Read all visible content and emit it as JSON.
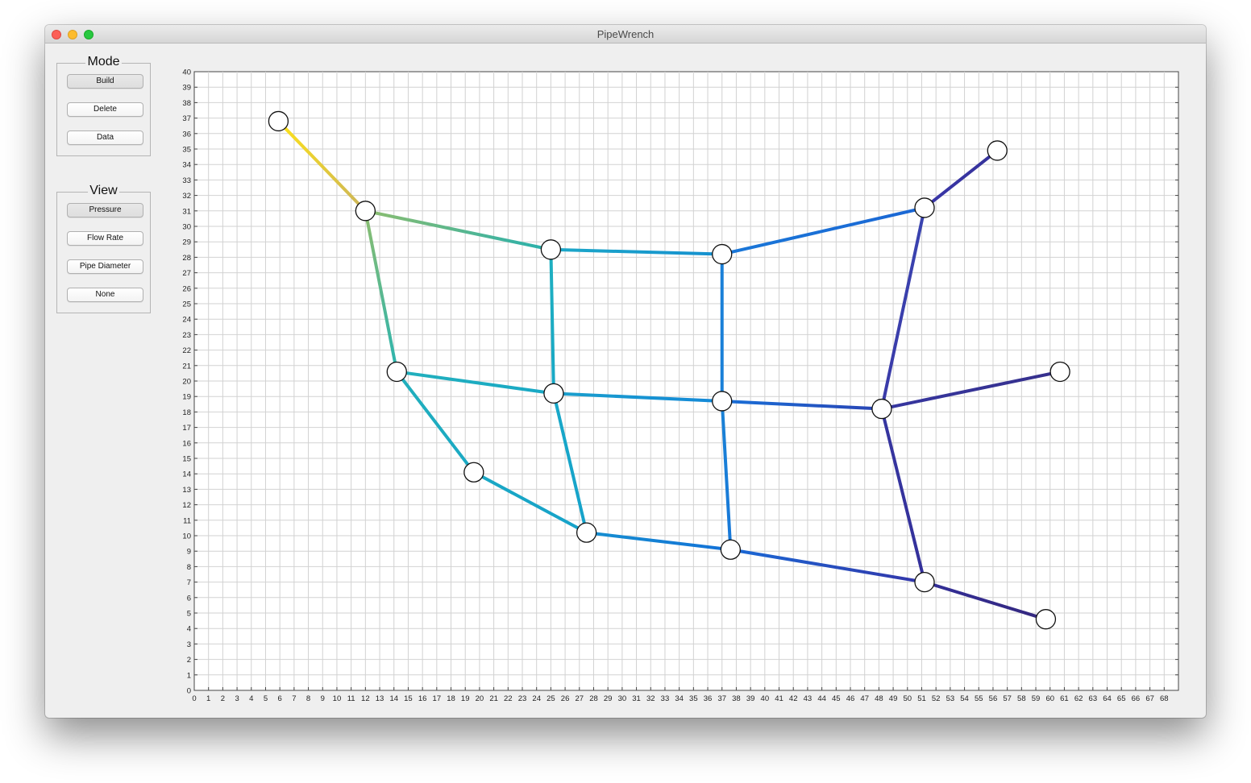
{
  "window": {
    "title": "PipeWrench"
  },
  "mode_panel": {
    "title": "Mode",
    "buttons": [
      {
        "label": "Build",
        "pressed": true
      },
      {
        "label": "Delete",
        "pressed": false
      },
      {
        "label": "Data",
        "pressed": false
      }
    ]
  },
  "view_panel": {
    "title": "View",
    "buttons": [
      {
        "label": "Pressure",
        "pressed": true
      },
      {
        "label": "Flow Rate",
        "pressed": false
      },
      {
        "label": "Pipe Diameter",
        "pressed": false
      },
      {
        "label": "None",
        "pressed": false
      }
    ]
  },
  "chart_data": {
    "type": "scatter",
    "title": "",
    "xlabel": "",
    "ylabel": "",
    "xlim": [
      0,
      69
    ],
    "ylim": [
      0,
      40
    ],
    "x_ticks_step": 1,
    "y_ticks_step": 1,
    "grid": true,
    "nodes": [
      {
        "id": "n1",
        "x": 5.9,
        "y": 36.8,
        "value_color": "#f5dc1e"
      },
      {
        "id": "n2",
        "x": 12.0,
        "y": 31.0,
        "value_color": "#96c06a"
      },
      {
        "id": "n3",
        "x": 25.0,
        "y": 28.5,
        "value_color": "#20b0b8"
      },
      {
        "id": "n4",
        "x": 37.0,
        "y": 28.2,
        "value_color": "#1590d0"
      },
      {
        "id": "n5",
        "x": 51.2,
        "y": 31.2,
        "value_color": "#2a4ab0"
      },
      {
        "id": "n6",
        "x": 56.3,
        "y": 34.9,
        "value_color": "#33349a"
      },
      {
        "id": "n7",
        "x": 14.2,
        "y": 20.6,
        "value_color": "#2ab4b0"
      },
      {
        "id": "n8",
        "x": 25.2,
        "y": 19.2,
        "value_color": "#18a8c6"
      },
      {
        "id": "n9",
        "x": 37.0,
        "y": 18.7,
        "value_color": "#1488d8"
      },
      {
        "id": "n10",
        "x": 48.2,
        "y": 18.2,
        "value_color": "#3036a0"
      },
      {
        "id": "n11",
        "x": 60.7,
        "y": 20.6,
        "value_color": "#33308c"
      },
      {
        "id": "n12",
        "x": 19.6,
        "y": 14.1,
        "value_color": "#1aa8c4"
      },
      {
        "id": "n13",
        "x": 27.5,
        "y": 10.2,
        "value_color": "#16a2ca"
      },
      {
        "id": "n14",
        "x": 37.6,
        "y": 9.1,
        "value_color": "#126ed8"
      },
      {
        "id": "n15",
        "x": 51.2,
        "y": 7.0,
        "value_color": "#302e9c"
      },
      {
        "id": "n16",
        "x": 59.7,
        "y": 4.6,
        "value_color": "#33287e"
      }
    ],
    "pipes": [
      {
        "from": "n1",
        "to": "n2",
        "color_from": "#fde21a",
        "color_to": "#cbb45a"
      },
      {
        "from": "n2",
        "to": "n3",
        "color_from": "#8dbd6e",
        "color_to": "#26b0ae"
      },
      {
        "from": "n2",
        "to": "n7",
        "color_from": "#8dbd6e",
        "color_to": "#2ab4b0"
      },
      {
        "from": "n3",
        "to": "n4",
        "color_from": "#1ca8c8",
        "color_to": "#1590d0"
      },
      {
        "from": "n4",
        "to": "n5",
        "color_from": "#1a78d8",
        "color_to": "#1a66d4"
      },
      {
        "from": "n5",
        "to": "n6",
        "color_from": "#3a36a8",
        "color_to": "#35329a"
      },
      {
        "from": "n3",
        "to": "n8",
        "color_from": "#1fb0c0",
        "color_to": "#18a8c6"
      },
      {
        "from": "n4",
        "to": "n9",
        "color_from": "#1a80d8",
        "color_to": "#1a80d8"
      },
      {
        "from": "n5",
        "to": "n10",
        "color_from": "#3a44b0",
        "color_to": "#3a3aa8"
      },
      {
        "from": "n7",
        "to": "n8",
        "color_from": "#22b0bc",
        "color_to": "#18a8c6"
      },
      {
        "from": "n8",
        "to": "n9",
        "color_from": "#1aa0cc",
        "color_to": "#1488d8"
      },
      {
        "from": "n9",
        "to": "n10",
        "color_from": "#1870d8",
        "color_to": "#2a44b4"
      },
      {
        "from": "n10",
        "to": "n11",
        "color_from": "#3636a0",
        "color_to": "#36308c"
      },
      {
        "from": "n7",
        "to": "n12",
        "color_from": "#22b0bc",
        "color_to": "#1aa8c4"
      },
      {
        "from": "n8",
        "to": "n13",
        "color_from": "#18a8c8",
        "color_to": "#16a2ca"
      },
      {
        "from": "n9",
        "to": "n14",
        "color_from": "#1a82d6",
        "color_to": "#1878d8"
      },
      {
        "from": "n10",
        "to": "n15",
        "color_from": "#3636a0",
        "color_to": "#34309a"
      },
      {
        "from": "n12",
        "to": "n13",
        "color_from": "#1aa8c4",
        "color_to": "#16a2ca"
      },
      {
        "from": "n13",
        "to": "n14",
        "color_from": "#1690d0",
        "color_to": "#1270d8"
      },
      {
        "from": "n14",
        "to": "n15",
        "color_from": "#1a6ad6",
        "color_to": "#3334a8"
      },
      {
        "from": "n15",
        "to": "n16",
        "color_from": "#322e98",
        "color_to": "#35287e"
      }
    ]
  }
}
